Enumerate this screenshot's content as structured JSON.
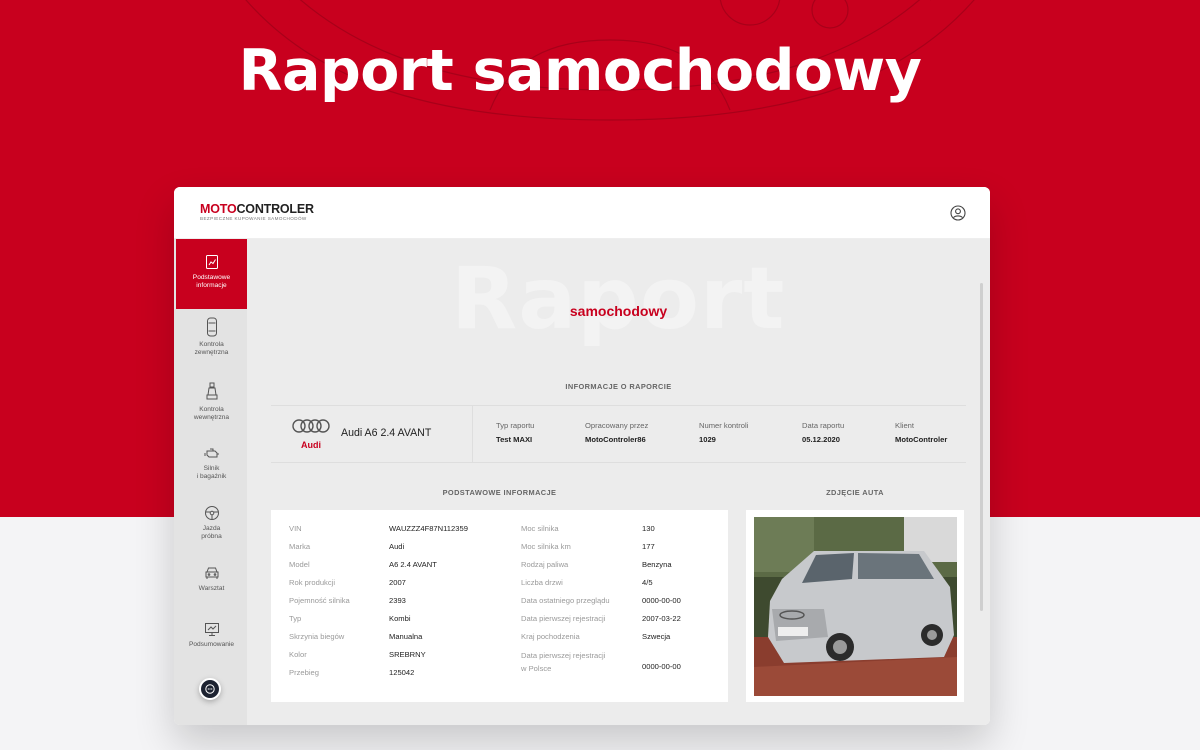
{
  "hero": {
    "title": "Raport samochodowy"
  },
  "header": {
    "logo": {
      "prefix": "MOTO",
      "main": "CONTROLER",
      "tagline": "BEZPIECZNE KUPOWANIE SAMOCHODÓW"
    },
    "user_icon": "user-circle-icon"
  },
  "sidebar": {
    "items": [
      {
        "label": "Podstawowe\ninformacje",
        "icon": "report-chart-icon",
        "active": true
      },
      {
        "label": "Kontrola\nzewnętrzna",
        "icon": "car-top-view-icon",
        "active": false
      },
      {
        "label": "Kontrola\nwewnętrzna",
        "icon": "car-seat-icon",
        "active": false
      },
      {
        "label": "Silnik\ni bagażnik",
        "icon": "engine-icon",
        "active": false
      },
      {
        "label": "Jazda\npróbna",
        "icon": "steering-wheel-icon",
        "active": false
      },
      {
        "label": "Warsztat",
        "icon": "car-front-icon",
        "active": false
      },
      {
        "label": "Podsumowanie",
        "icon": "presentation-chart-icon",
        "active": false
      }
    ],
    "chat_icon": "chat-bubble-icon"
  },
  "main": {
    "watermark": "Raport",
    "subtitle": "samochodowy",
    "report_info_heading": "INFORMACJE O RAPORCIE",
    "car": {
      "brand": "Audi",
      "model": "Audi A6 2.4 AVANT"
    },
    "report_meta": [
      {
        "label": "Typ raportu",
        "value": "Test MAXI"
      },
      {
        "label": "Opracowany przez",
        "value": "MotoControler86"
      },
      {
        "label": "Numer kontroli",
        "value": "1029"
      },
      {
        "label": "Data raportu",
        "value": "05.12.2020"
      },
      {
        "label": "Klient",
        "value": "MotoControler"
      }
    ],
    "basic_info_heading": "PODSTAWOWE INFORMACJE",
    "photo_heading": "ZDJĘCIE AUTA",
    "basic_info_left": [
      {
        "label": "VIN",
        "value": "WAUZZZ4F87N112359"
      },
      {
        "label": "Marka",
        "value": "Audi"
      },
      {
        "label": "Model",
        "value": "A6 2.4 AVANT"
      },
      {
        "label": "Rok produkcji",
        "value": "2007"
      },
      {
        "label": "Pojemność silnika",
        "value": "2393"
      },
      {
        "label": "Typ",
        "value": "Kombi"
      },
      {
        "label": "Skrzynia biegów",
        "value": "Manualna"
      },
      {
        "label": "Kolor",
        "value": "SREBRNY"
      },
      {
        "label": "Przebieg",
        "value": "125042"
      }
    ],
    "basic_info_right": [
      {
        "label": "Moc silnika",
        "value": "130"
      },
      {
        "label": "Moc silnika km",
        "value": "177"
      },
      {
        "label": "Rodzaj paliwa",
        "value": "Benzyna"
      },
      {
        "label": "Liczba drzwi",
        "value": "4/5"
      },
      {
        "label": "Data ostatniego przeglądu",
        "value": "0000-00-00"
      },
      {
        "label": "Data pierwszej rejestracji",
        "value": "2007-03-22"
      },
      {
        "label": "Kraj pochodzenia",
        "value": "Szwecja"
      },
      {
        "label": "Data pierwszej rejestracji\nw Polsce",
        "value": "0000-00-00"
      }
    ]
  }
}
